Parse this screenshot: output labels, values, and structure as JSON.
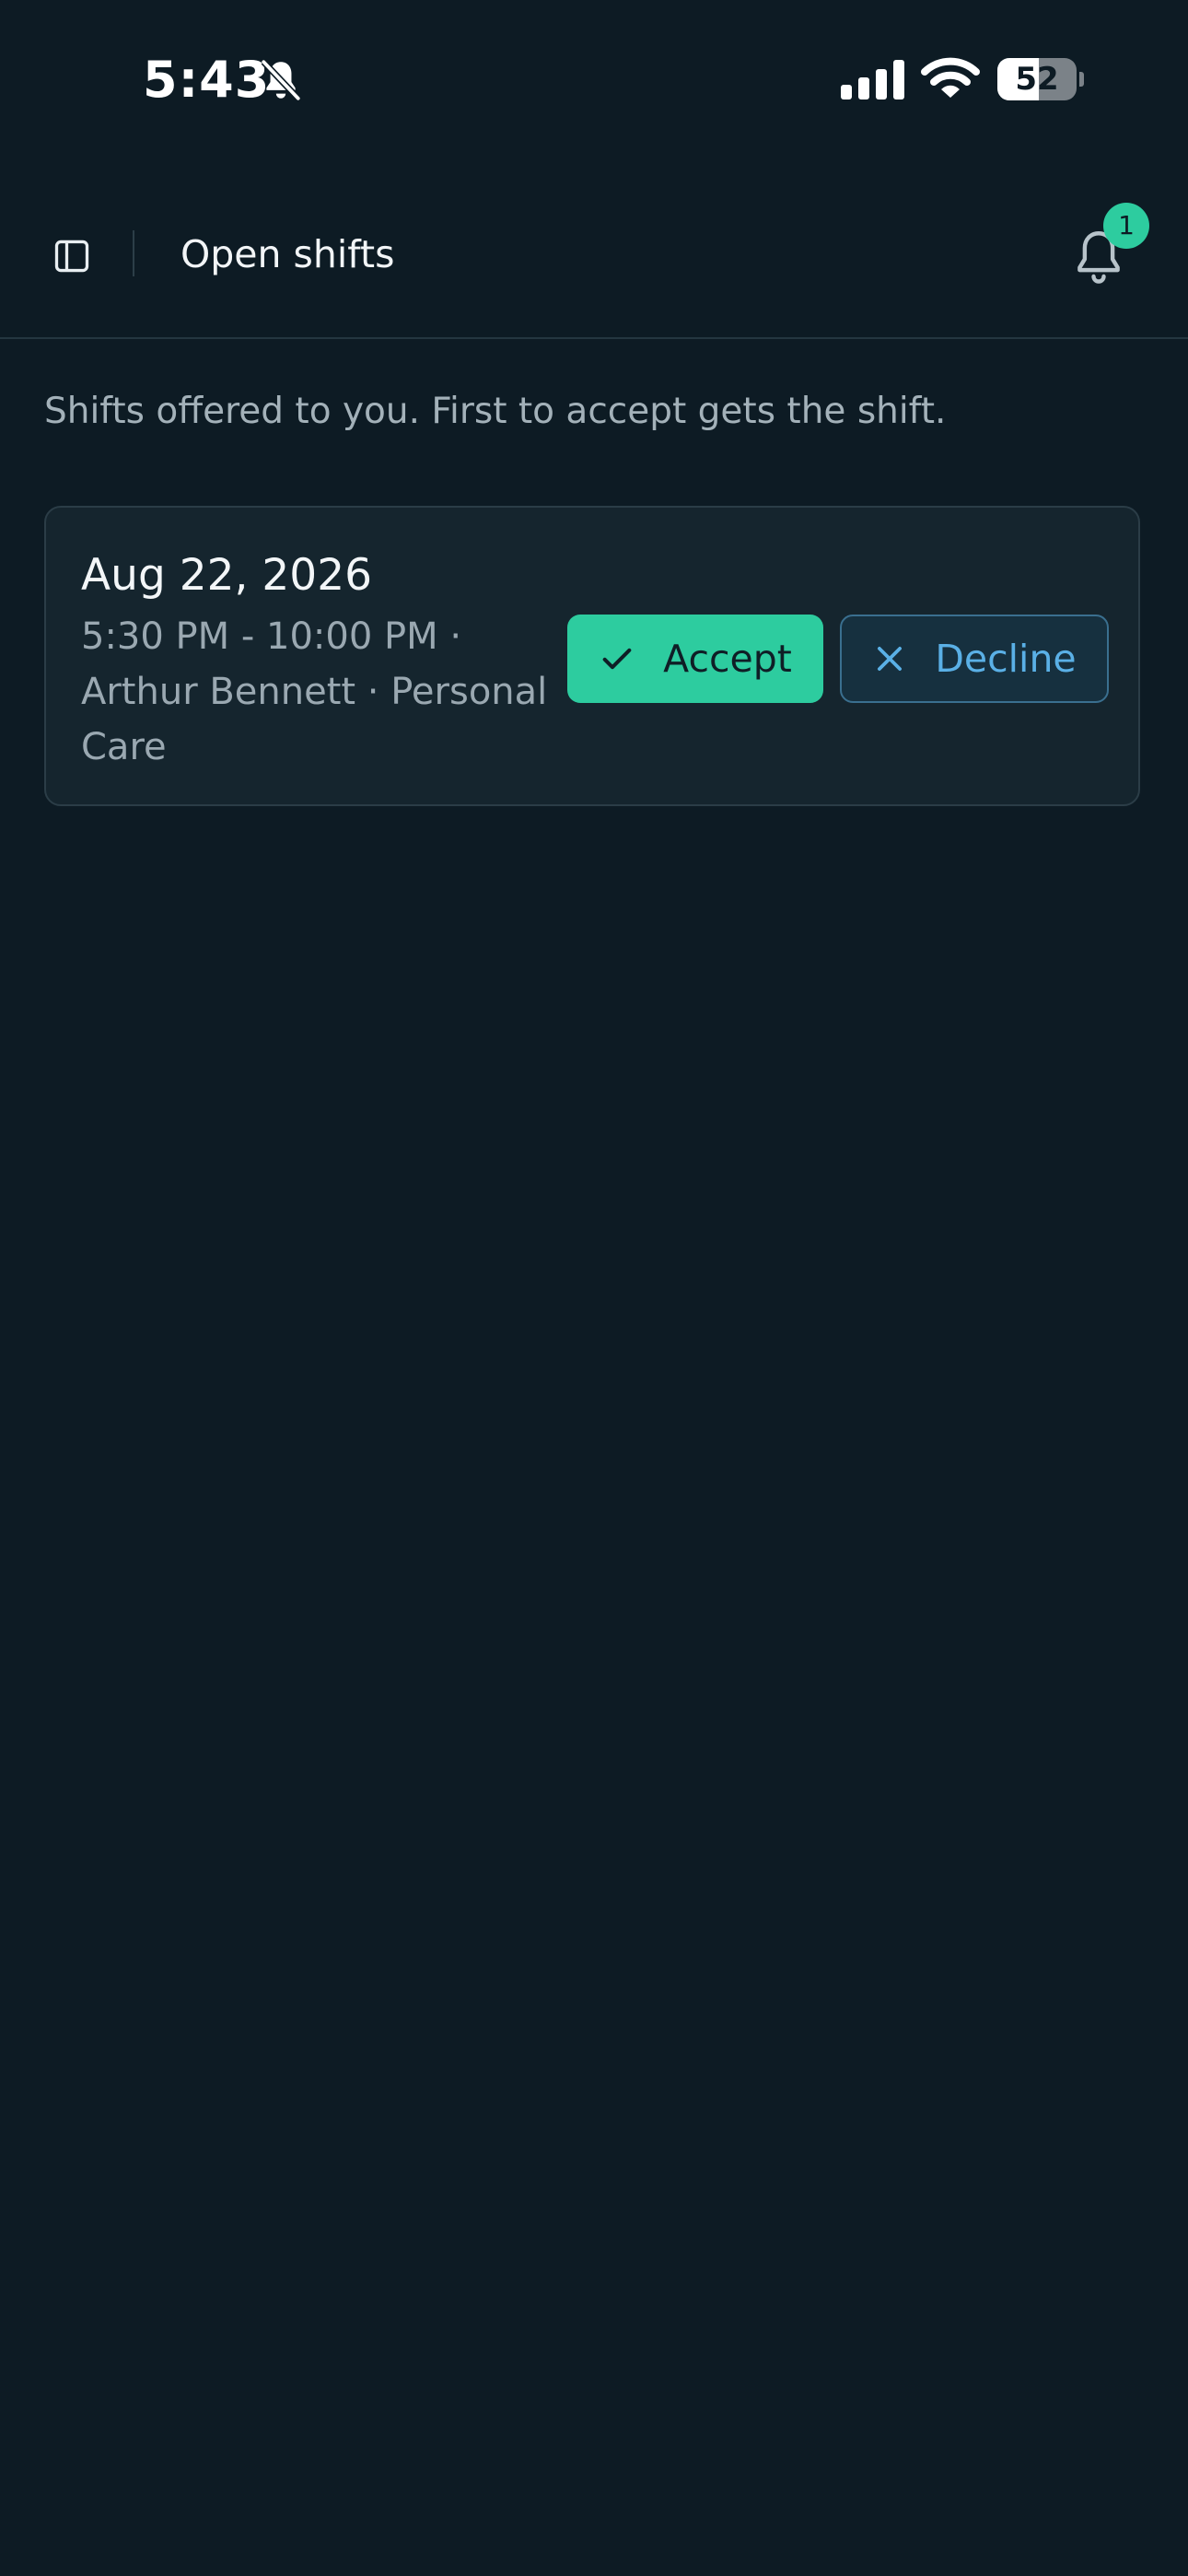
{
  "status_bar": {
    "time": "5:43",
    "battery": "52",
    "battery_level_percent": 52
  },
  "header": {
    "title": "Open shifts",
    "notification_count": "1"
  },
  "intro_text": "Shifts offered to you. First to accept gets the shift.",
  "shifts": [
    {
      "date": "Aug 22, 2026",
      "details": "5:30 PM - 10:00 PM · Arthur Bennett · Personal Care",
      "accept_label": "Accept",
      "decline_label": "Decline"
    }
  ],
  "colors": {
    "background": "#0d1b24",
    "card": "#15252e",
    "accent": "#2dcc9f",
    "decline_text": "#5ab0e6"
  },
  "icons": {
    "status": [
      "bell-slash-icon",
      "cellular-signal-icon",
      "wifi-icon",
      "battery-icon"
    ],
    "header": [
      "sidebar-toggle-icon",
      "bell-icon"
    ],
    "buttons": [
      "checkmark-icon",
      "x-icon"
    ]
  }
}
